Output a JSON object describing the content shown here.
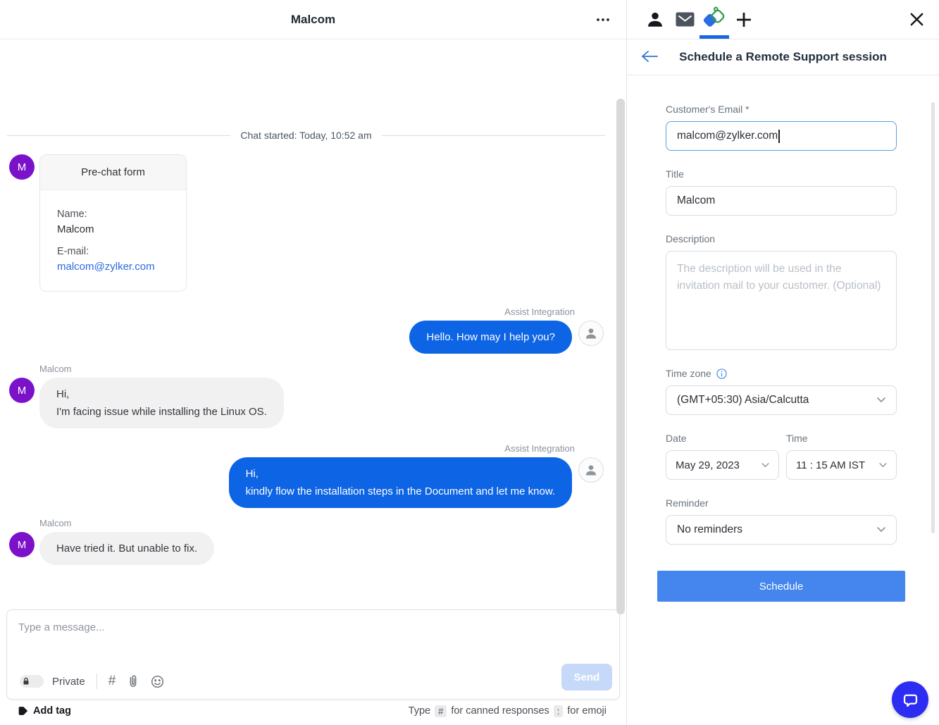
{
  "left_panel": {
    "header": {
      "title": "Malcom"
    },
    "chat": {
      "divider_text": "Chat started: Today, 10:52 am",
      "prechat_form": {
        "title": "Pre-chat form",
        "avatar_initial": "M",
        "name_label": "Name:",
        "name_value": "Malcom",
        "email_label": "E-mail:",
        "email_value": "malcom@zylker.com"
      },
      "messages": [
        {
          "sender": "Assist Integration",
          "side": "right",
          "line1": "Hello. How may I help you?",
          "line2": ""
        },
        {
          "sender": "Malcom",
          "side": "left",
          "line1": "Hi,",
          "line2": "I'm facing issue while installing the Linux OS."
        },
        {
          "sender": "Assist Integration",
          "side": "right",
          "line1": "Hi,",
          "line2": "kindly flow the installation steps in the Document and let me know."
        },
        {
          "sender": "Malcom",
          "side": "left",
          "line1": "Have tried it. But unable to fix.",
          "line2": ""
        }
      ]
    },
    "composer": {
      "placeholder": "Type a message...",
      "private_label": "Private",
      "send_label": "Send"
    },
    "footer": {
      "add_tag_label": "Add tag",
      "hint_prefix": "Type",
      "hint_hash_key": "#",
      "hint_canned": "for canned responses",
      "hint_colon_key": ":",
      "hint_emoji": "for emoji"
    }
  },
  "right_panel": {
    "title": "Schedule a Remote Support session",
    "form": {
      "email_label": "Customer's Email *",
      "email_value": "malcom@zylker.com",
      "title_label": "Title",
      "title_value": "Malcom",
      "description_label": "Description",
      "description_placeholder": "The description will be used in the invitation mail to your customer. (Optional)",
      "timezone_label": "Time zone",
      "timezone_value": "(GMT+05:30) Asia/Calcutta",
      "date_label": "Date",
      "date_value": "May 29, 2023",
      "time_label": "Time",
      "time_value": "11 : 15 AM IST",
      "reminder_label": "Reminder",
      "reminder_value": "No reminders",
      "submit_label": "Schedule"
    }
  },
  "icons": {
    "top_tabs": [
      "contact-icon",
      "mail-icon",
      "assist-logo-icon",
      "plus-icon"
    ],
    "active_tab": "assist-logo-icon"
  },
  "colors": {
    "bubble_blue": "#0d64e4",
    "link_blue": "#2b6cdf",
    "avatar_purple": "#7b12c9",
    "active_tab_underline": "#1668e3",
    "schedule_button": "#4485ee",
    "send_disabled_bg": "#c7d9f8",
    "widget_blue": "#2d2cf2",
    "focused_input_border": "#53a0e8"
  }
}
